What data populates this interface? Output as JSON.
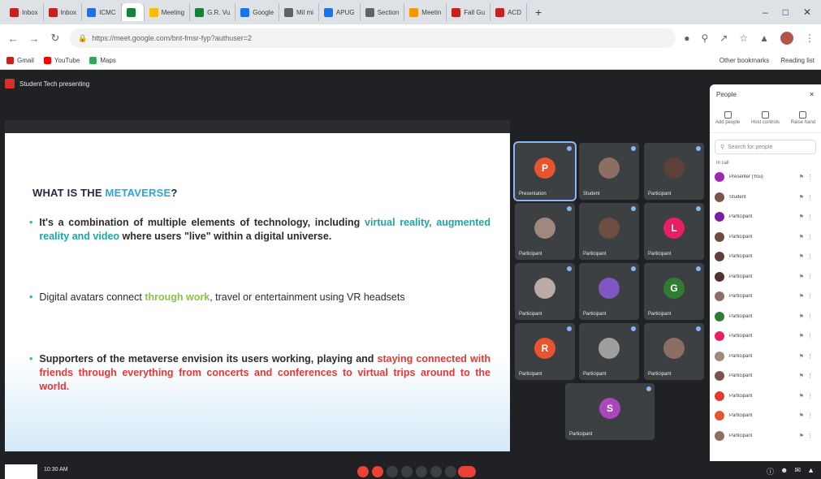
{
  "browser": {
    "tabs": [
      {
        "label": "Inbox",
        "color": "#c5221f"
      },
      {
        "label": "Inbox",
        "color": "#c5221f"
      },
      {
        "label": "ICMC",
        "color": "#1a73e8"
      },
      {
        "label": "",
        "color": "#188038",
        "active": true
      },
      {
        "label": "Meeting",
        "color": "#fbbc04"
      },
      {
        "label": "G.R. Vu",
        "color": "#188038"
      },
      {
        "label": "Google",
        "color": "#1a73e8"
      },
      {
        "label": "Mil mi",
        "color": "#5f6368"
      },
      {
        "label": "APUG",
        "color": "#1a73e8"
      },
      {
        "label": "Section",
        "color": "#5f6368"
      },
      {
        "label": "Meetin",
        "color": "#f29900"
      },
      {
        "label": "Fall Gu",
        "color": "#c5221f"
      },
      {
        "label": "ACD",
        "color": "#c5221f"
      }
    ],
    "new_tab": "+",
    "url": "https://meet.google.com/bnt-fmsr-fyp?authuser=2",
    "bookmarks": [
      {
        "label": "Gmail",
        "color": "#c5221f"
      },
      {
        "label": "YouTube",
        "color": "#ff0000"
      },
      {
        "label": "Maps",
        "color": "#34a853"
      }
    ],
    "bookmarks_right": [
      "Other bookmarks",
      "Reading list"
    ]
  },
  "meet": {
    "presenter_label": "Student Tech presenting",
    "slide": {
      "title_prefix": "WHAT IS THE ",
      "title_highlight": "METAVERSE",
      "title_suffix": "?",
      "bullet1_a": "It's a combination of multiple elements of technology, including ",
      "bullet1_b": "virtual reality, augmented reality and video",
      "bullet1_c": " where users \"live\" within a digital universe.",
      "bullet2_a": "Digital avatars connect ",
      "bullet2_b": "through work",
      "bullet2_c": ", travel or entertainment using VR headsets",
      "bullet3_a": "Supporters of the metaverse envision its users working, playing and ",
      "bullet3_b": "staying connected with friends through everything from concerts and conferences to virtual trips around to the world."
    },
    "tiles": [
      {
        "name": "Presentation",
        "initial": "P",
        "color": "#e8542d",
        "selected": true
      },
      {
        "name": "Student",
        "initial": "",
        "color": "#8d6e63"
      },
      {
        "name": "Participant",
        "initial": "",
        "color": "#5d4037"
      },
      {
        "name": "Participant",
        "initial": "",
        "color": "#a1887f"
      },
      {
        "name": "Participant",
        "initial": "",
        "color": "#6d4c41"
      },
      {
        "name": "Participant",
        "initial": "L",
        "color": "#e91e63"
      },
      {
        "name": "Participant",
        "initial": "",
        "color": "#bcaaa4"
      },
      {
        "name": "Participant",
        "initial": "",
        "color": "#7e57c2"
      },
      {
        "name": "Participant",
        "initial": "G",
        "color": "#2e7d32"
      },
      {
        "name": "Participant",
        "initial": "R",
        "color": "#e8542d"
      },
      {
        "name": "Participant",
        "initial": "",
        "color": "#9e9e9e"
      },
      {
        "name": "Participant",
        "initial": "",
        "color": "#8d6e63"
      },
      {
        "name": "Participant",
        "initial": "S",
        "color": "#ab47bc"
      }
    ]
  },
  "people": {
    "title": "People",
    "actions": [
      "Add people",
      "Host controls",
      "Raise hand"
    ],
    "search_placeholder": "Search for people",
    "in_call_label": "In call",
    "list": [
      {
        "name": "Presenter (You)",
        "color": "#9c27b0"
      },
      {
        "name": "Student",
        "color": "#795548"
      },
      {
        "name": "Participant",
        "color": "#7b1fa2"
      },
      {
        "name": "Participant",
        "color": "#6d4c41"
      },
      {
        "name": "Participant",
        "color": "#5d4037"
      },
      {
        "name": "Participant",
        "color": "#4e342e"
      },
      {
        "name": "Participant",
        "color": "#8d6e63"
      },
      {
        "name": "Participant",
        "color": "#2e7d32"
      },
      {
        "name": "Participant",
        "color": "#e91e63"
      },
      {
        "name": "Participant",
        "color": "#a1887f"
      },
      {
        "name": "Participant",
        "color": "#795548"
      },
      {
        "name": "Participant",
        "color": "#e53935"
      },
      {
        "name": "Participant",
        "color": "#e8542d"
      },
      {
        "name": "Participant",
        "color": "#8d6e63"
      }
    ]
  },
  "bottom": {
    "time": "10:30 AM"
  }
}
